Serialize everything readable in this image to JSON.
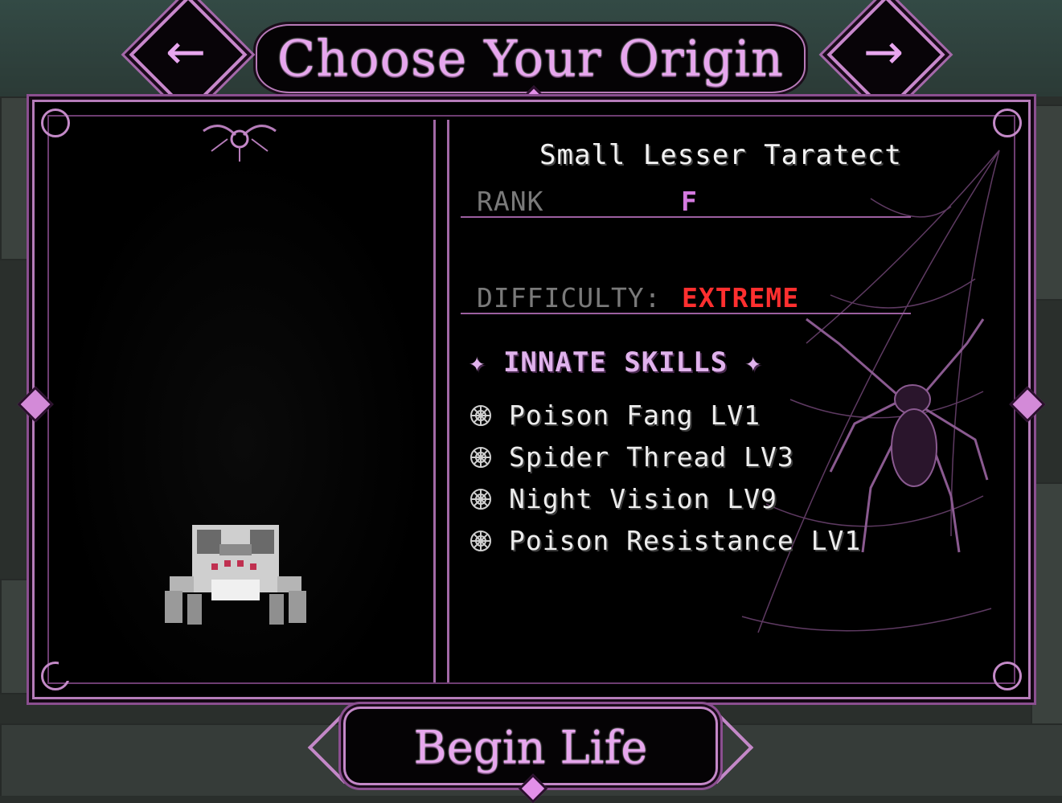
{
  "header": {
    "title": "Choose Your Origin",
    "prev_arrow": "←",
    "next_arrow": "→"
  },
  "origin": {
    "name": "Small Lesser Taratect",
    "rank_label": "RANK",
    "rank_value": "F",
    "difficulty_label": "DIFFICULTY:",
    "difficulty_value": "EXTREME",
    "skills_heading": "✦ INNATE SKILLS ✦",
    "skills": [
      "Poison Fang LV1",
      "Spider Thread LV3",
      "Night Vision LV9",
      "Poison Resistance LV1"
    ],
    "skill_icon": "spiderweb-icon"
  },
  "footer": {
    "begin_label": "Begin Life"
  },
  "colors": {
    "accent": "#e7a6ee",
    "frame": "#b57cb9",
    "rank": "#d57ae0",
    "difficulty": "#ff2f2f",
    "label_gray": "#7a7a7a"
  }
}
